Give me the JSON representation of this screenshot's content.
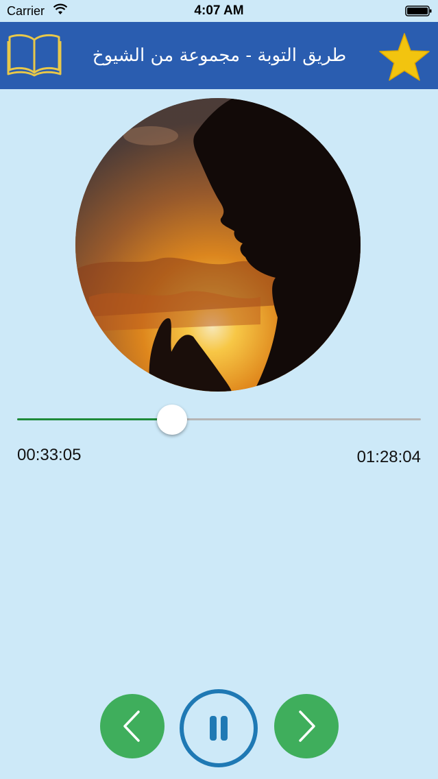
{
  "status_bar": {
    "carrier": "Carrier",
    "time": "4:07 AM",
    "wifi_icon": "wifi-icon",
    "battery_icon": "battery-icon"
  },
  "nav": {
    "title": "طريق التوبة - مجموعة من الشيوخ",
    "left_icon": "book-icon",
    "right_icon": "star-icon",
    "background_color": "#2a5db0",
    "star_color": "#f2c40f",
    "book_color": "#e8c84a"
  },
  "player": {
    "artwork_icon": "artwork-image",
    "elapsed": "00:33:05",
    "duration": "01:28:04",
    "progress_fraction": 0.383,
    "track_fill_color": "#1e8a3a"
  },
  "controls": {
    "previous_icon": "chevron-left-icon",
    "pause_icon": "pause-icon",
    "next_icon": "chevron-right-icon",
    "nav_button_color": "#3fae5c",
    "pause_ring_color": "#1f79b4"
  }
}
